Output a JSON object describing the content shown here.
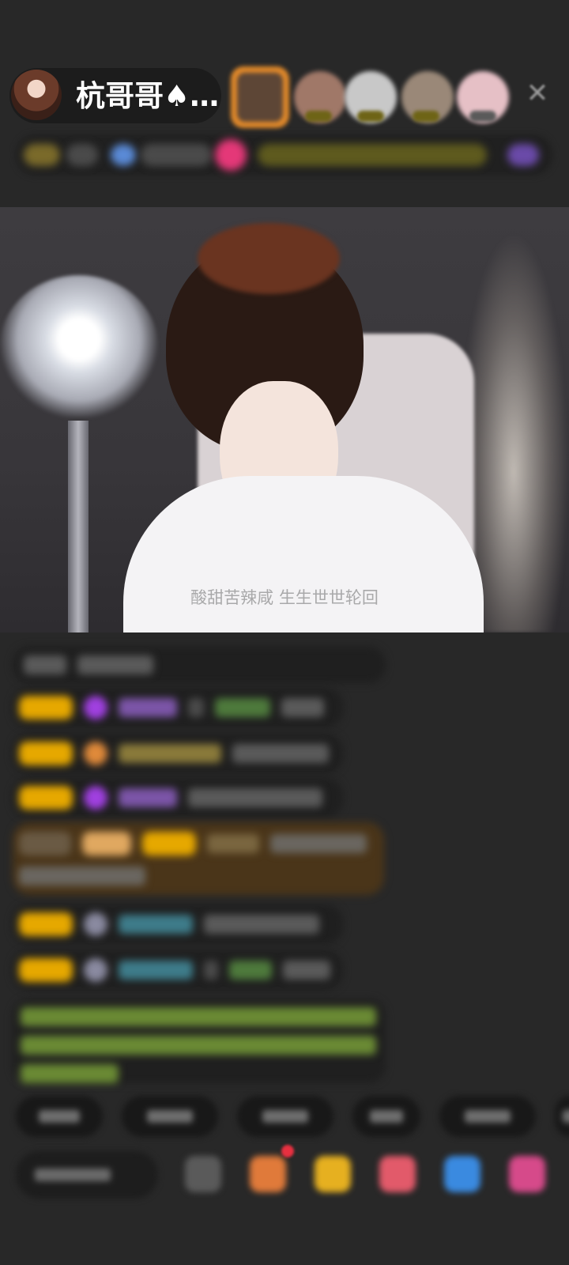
{
  "app": {
    "host_name": "杭哥哥♠…"
  },
  "stream": {
    "caption": "酸甜苦辣咸 生生世世轮回"
  },
  "top_controls": {
    "close_glyph": "✕"
  },
  "colors": {
    "background": "#282828",
    "caption": "#a9a9aa",
    "chat_bubble": "#1f1f1f",
    "highlight_bubble": "#4a3519",
    "level_badge": "#e6a800",
    "notification_dot": "#e83040"
  }
}
